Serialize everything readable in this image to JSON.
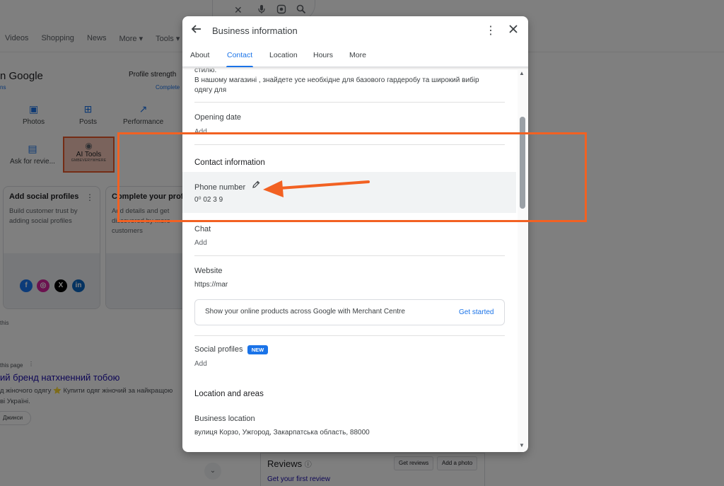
{
  "background": {
    "search_icons": [
      "✕",
      "mic-icon",
      "lens-icon",
      "search-icon"
    ],
    "nav_tabs": [
      "Videos",
      "Shopping",
      "News",
      "More ▾",
      "Tools ▾"
    ],
    "business_title": "n Google",
    "business_sub": "ns",
    "profile_strength": "Profile strength",
    "complete": "Complete",
    "actions": [
      {
        "label": "Photos",
        "icon": "photos-icon"
      },
      {
        "label": "Posts",
        "icon": "posts-icon"
      },
      {
        "label": "Performance",
        "icon": "performance-icon"
      }
    ],
    "ask_reviews": "Ask for revie...",
    "ai_tools_label": "AI Tools",
    "ai_tools_sub": "GMBEVERYWHERE",
    "card_social_title": "Add social profiles",
    "card_social_desc": "Build customer trust by adding social profiles",
    "card_complete_title": "Complete your profile",
    "card_complete_desc": "Add details and get discovered by more customers",
    "this_text": "this",
    "this_page": "this page",
    "result_link": "ий бренд натхненний тобою",
    "snippet_1": "д жіночого одягу ⭐ Купити одяг жіночий за найкращою",
    "snippet_2": "ві Україні.",
    "chip": "Джинси",
    "reviews_title": "Reviews",
    "reviews_link": "Get your first review",
    "get_reviews": "Get reviews",
    "add_photo": "Add a photo"
  },
  "dialog": {
    "title": "Business information",
    "tabs": [
      "About",
      "Contact",
      "Location",
      "Hours",
      "More"
    ],
    "active_tab": "Contact",
    "desc_line0": "стилю.",
    "desc_line1": "В нашому магазині   , знайдете усе необхідне для базового гардеробу та широкий вибір",
    "desc_line2": "одягу для",
    "opening_date_label": "Opening date",
    "opening_date_value": "Add",
    "contact_section": "Contact information",
    "phone_label": "Phone number",
    "phone_value": "0⁰  02  3  9",
    "chat_label": "Chat",
    "chat_value": "Add",
    "website_label": "Website",
    "website_value": "https://mar",
    "merchant_text": "Show your online products across Google with Merchant Centre",
    "merchant_button": "Get started",
    "social_label": "Social profiles",
    "social_badge": "NEW",
    "social_value": "Add",
    "location_section": "Location and areas",
    "business_location_label": "Business location",
    "business_location_value": "вулиця Корзо,        Ужгород, Закарпатська область, 88000"
  },
  "colors": {
    "accent": "#1a73e8",
    "annotation": "#f26122"
  }
}
